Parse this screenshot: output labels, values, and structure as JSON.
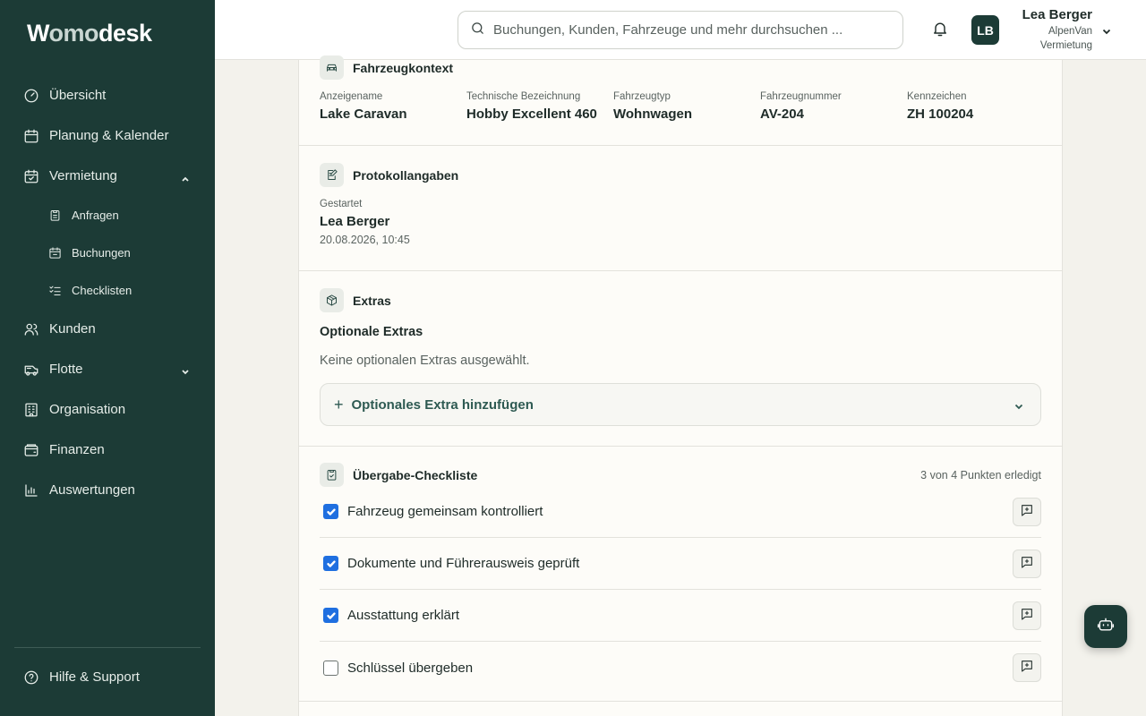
{
  "app": {
    "logo_w": "W",
    "logo_omo": "omo",
    "logo_desk": "desk"
  },
  "sidebar": {
    "items": [
      {
        "label": "Übersicht",
        "icon": "gauge-icon"
      },
      {
        "label": "Planung & Kalender",
        "icon": "calendar-icon"
      },
      {
        "label": "Vermietung",
        "icon": "calendar-check-icon",
        "expanded": true
      },
      {
        "label": "Kunden",
        "icon": "users-icon"
      },
      {
        "label": "Flotte",
        "icon": "vehicle-icon",
        "expanded": false
      },
      {
        "label": "Organisation",
        "icon": "building-icon"
      },
      {
        "label": "Finanzen",
        "icon": "wallet-icon"
      },
      {
        "label": "Auswertungen",
        "icon": "bar-chart-icon"
      }
    ],
    "sub_items": [
      {
        "label": "Anfragen",
        "icon": "clipboard-icon"
      },
      {
        "label": "Buchungen",
        "icon": "calendar-icon"
      },
      {
        "label": "Checklisten",
        "icon": "list-check-icon"
      }
    ],
    "help_label": "Hilfe & Support"
  },
  "header": {
    "search_placeholder": "Buchungen, Kunden, Fahrzeuge und mehr durchsuchen ...",
    "avatar_initials": "LB",
    "user_name": "Lea Berger",
    "user_org_line1": "AlpenVan",
    "user_org_line2": "Vermietung"
  },
  "vehicle_context": {
    "title": "Fahrzeugkontext",
    "fields": [
      {
        "label": "Anzeigename",
        "value": "Lake Caravan"
      },
      {
        "label": "Technische Bezeichnung",
        "value": "Hobby Excellent 460"
      },
      {
        "label": "Fahrzeugtyp",
        "value": "Wohnwagen"
      },
      {
        "label": "Fahrzeugnummer",
        "value": "AV-204"
      },
      {
        "label": "Kennzeichen",
        "value": "ZH 100204"
      }
    ]
  },
  "protocol": {
    "title": "Protokollangaben",
    "started_label": "Gestartet",
    "started_by": "Lea Berger",
    "started_at": "20.08.2026, 10:45"
  },
  "extras": {
    "title": "Extras",
    "optional_title": "Optionale Extras",
    "none_text": "Keine optionalen Extras ausgewählt.",
    "add_label": "Optionales Extra hinzufügen"
  },
  "checklist": {
    "title": "Übergabe-Checkliste",
    "progress": "3 von 4 Punkten erledigt",
    "items": [
      {
        "label": "Fahrzeug gemeinsam kontrolliert",
        "checked": true
      },
      {
        "label": "Dokumente und Führerausweis geprüft",
        "checked": true
      },
      {
        "label": "Ausstattung erklärt",
        "checked": true
      },
      {
        "label": "Schlüssel übergeben",
        "checked": false
      }
    ]
  },
  "colors": {
    "sidebar_bg": "#1c3b36",
    "checkbox_on": "#1f6fe0",
    "accent_text": "#2e5a52"
  }
}
